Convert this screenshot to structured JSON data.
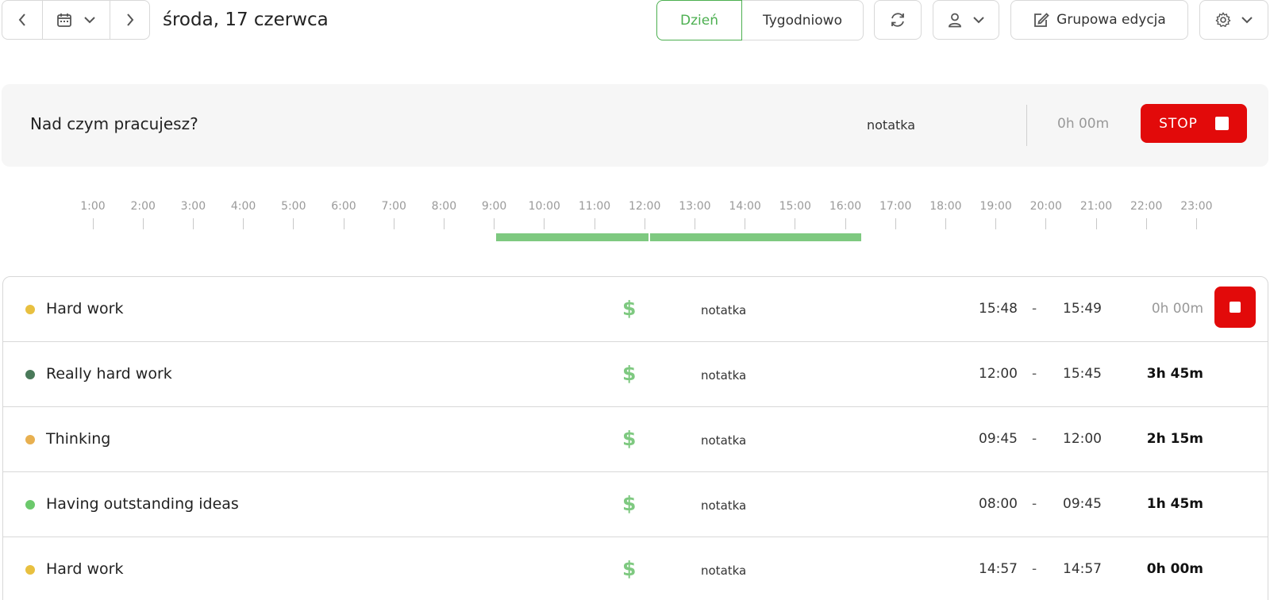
{
  "header": {
    "date_title": "środa, 17 czerwca",
    "view_day_label": "Dzień",
    "view_week_label": "Tygodniowo",
    "group_edit_label": "Grupowa edycja",
    "active_view": "Dzień"
  },
  "tracker": {
    "placeholder": "Nad czym pracujesz?",
    "note_label": "notatka",
    "duration": "0h 00m",
    "stop_label": "STOP"
  },
  "timeline": {
    "hours": [
      "1:00",
      "2:00",
      "3:00",
      "4:00",
      "5:00",
      "6:00",
      "7:00",
      "8:00",
      "9:00",
      "10:00",
      "11:00",
      "12:00",
      "13:00",
      "14:00",
      "15:00",
      "16:00",
      "17:00",
      "18:00",
      "19:00",
      "20:00",
      "21:00",
      "22:00",
      "23:00"
    ],
    "bar_color": "#7ec980"
  },
  "entries": [
    {
      "name": "Hard work",
      "color": "#e8c040",
      "note": "notatka",
      "start": "15:48",
      "end": "15:49",
      "duration": "0h 00m",
      "running": true
    },
    {
      "name": "Really hard work",
      "color": "#4a7a5a",
      "note": "notatka",
      "start": "12:00",
      "end": "15:45",
      "duration": "3h 45m",
      "running": false
    },
    {
      "name": "Thinking",
      "color": "#e8b050",
      "note": "notatka",
      "start": "09:45",
      "end": "12:00",
      "duration": "2h 15m",
      "running": false
    },
    {
      "name": "Having outstanding ideas",
      "color": "#6cc96c",
      "note": "notatka",
      "start": "08:00",
      "end": "09:45",
      "duration": "1h 45m",
      "running": false
    },
    {
      "name": "Hard work",
      "color": "#e8c040",
      "note": "notatka",
      "start": "14:57",
      "end": "14:57",
      "duration": "0h 00m",
      "running": false
    }
  ],
  "colors": {
    "accent_green": "#4caf50",
    "stop_red": "#e20a0a"
  }
}
